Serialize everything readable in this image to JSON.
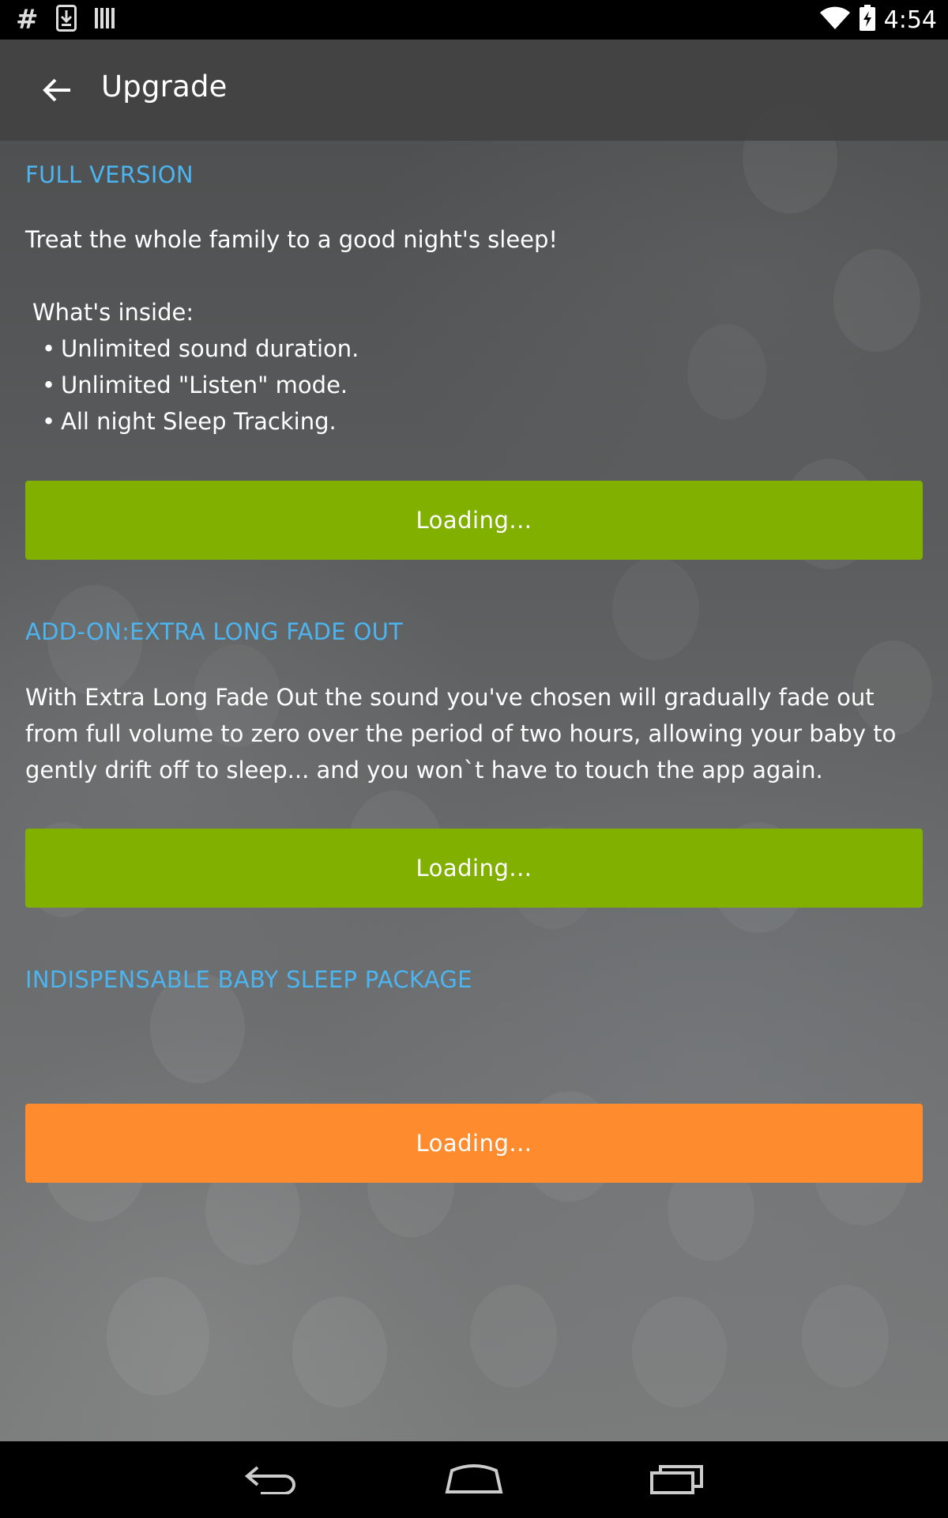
{
  "status_bar": {
    "icons_left": [
      "hash-icon",
      "download-icon",
      "barcode-icon"
    ],
    "hash_glyph": "#",
    "icons_right": [
      "wifi-icon",
      "battery-charging-icon"
    ],
    "time": "4:54"
  },
  "app_bar": {
    "back_icon": "arrow-back-icon",
    "title": "Upgrade"
  },
  "full_version": {
    "title": "FULL VERSION",
    "description": "Treat the whole family to a good night's sleep!",
    "inside_label": "What's inside:",
    "features": [
      "Unlimited sound duration.",
      "Unlimited \"Listen\" mode.",
      "All night Sleep Tracking."
    ],
    "button_label": "Loading..."
  },
  "addon_fade": {
    "title": "ADD-ON:EXTRA LONG FADE OUT",
    "description": "With Extra Long Fade Out the sound you've chosen will gradually fade out from full volume to zero over the period of two hours, allowing your baby to gently drift off to sleep... and you won`t have to touch the app again.",
    "button_label": "Loading..."
  },
  "baby_package": {
    "title": "INDISPENSABLE BABY SLEEP PACKAGE",
    "button_label": "Loading..."
  },
  "colors": {
    "accent": "#4cb4ef",
    "green_button": "#82b000",
    "orange_button": "#fe8c2f",
    "app_bar": "#424242"
  },
  "nav_bar": {
    "icons": [
      "nav-back-icon",
      "nav-home-icon",
      "nav-recents-icon"
    ]
  }
}
